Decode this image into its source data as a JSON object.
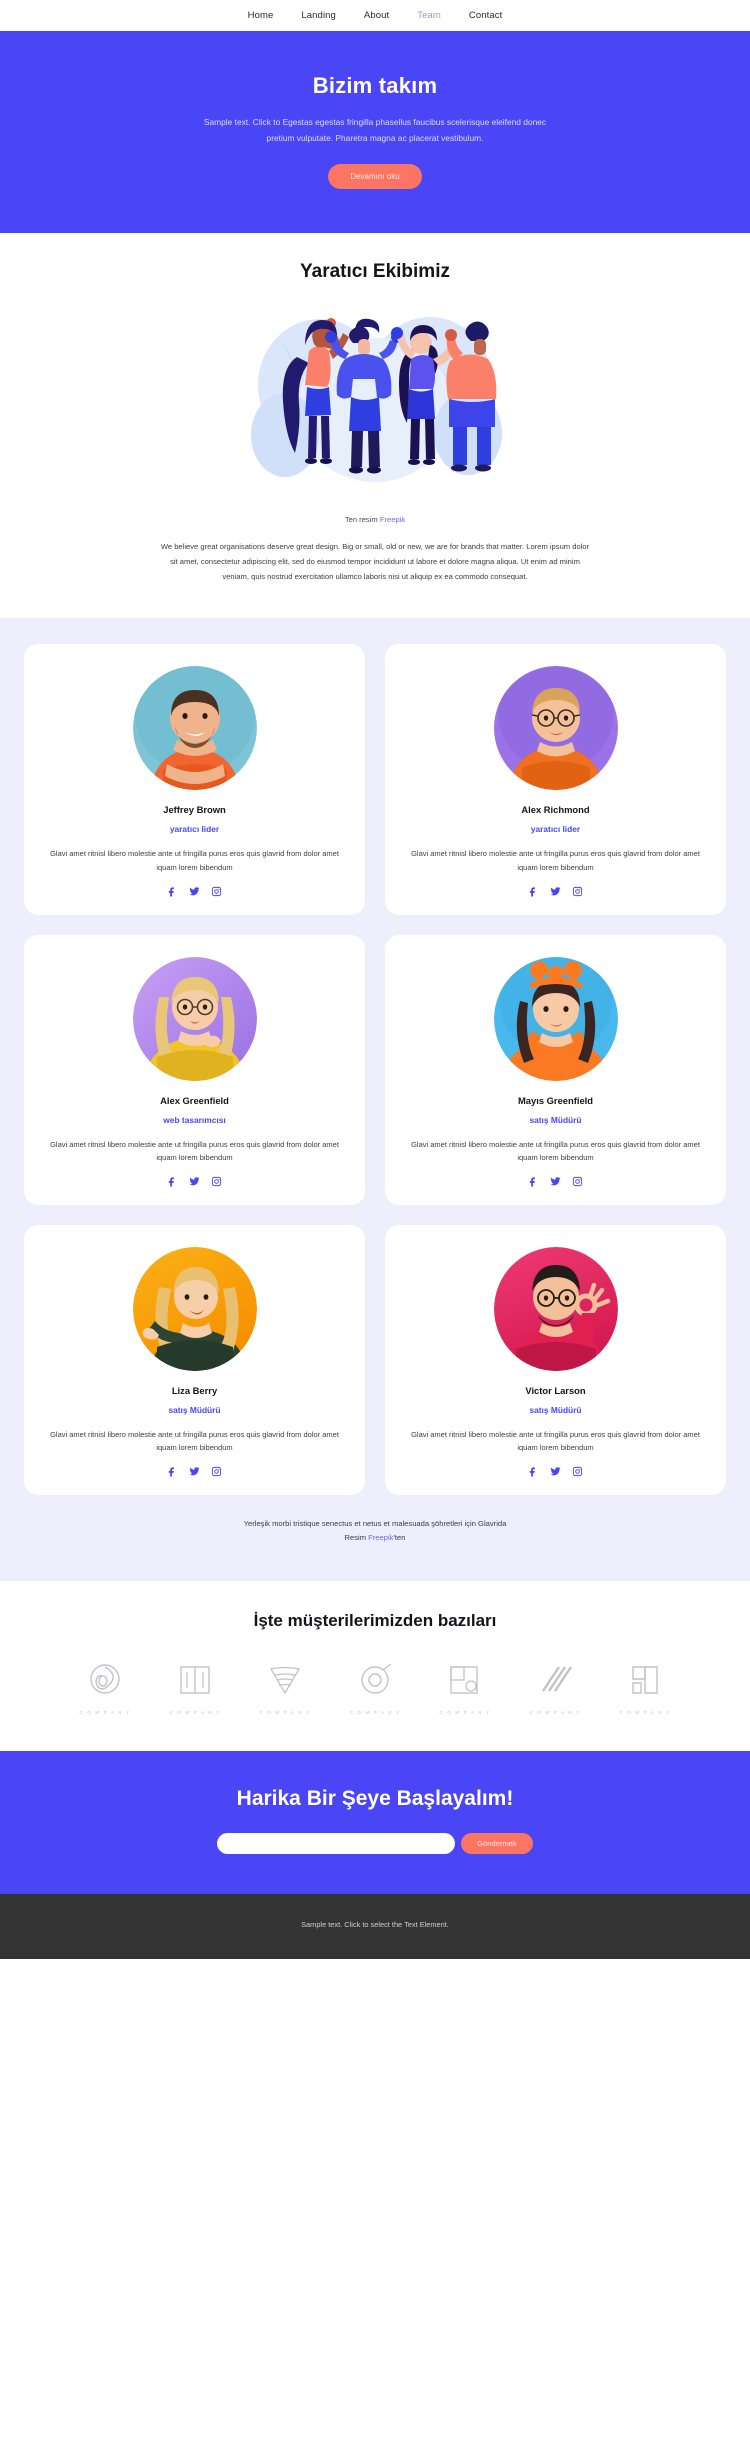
{
  "nav": {
    "items": [
      {
        "label": "Home",
        "active": false
      },
      {
        "label": "Landing",
        "active": false
      },
      {
        "label": "About",
        "active": false
      },
      {
        "label": "Team",
        "active": true
      },
      {
        "label": "Contact",
        "active": false
      }
    ]
  },
  "hero": {
    "title": "Bizim takım",
    "subtitle": "Sample text. Click to Egestas egestas fringilla phasellus faucibus scelerisque eleifend donec pretium vulputate. Pharetra magna ac placerat vestibulum.",
    "cta_label": "Devamını oku",
    "bg_color": "#4a46f5",
    "button_color": "#fc7563"
  },
  "creative": {
    "title": "Yaratıcı Ekibimiz",
    "image_credit_prefix": "Ten resim ",
    "image_credit_link": "Freepik",
    "body": "We believe great organisations deserve great design. Big or small, old or new, we are for brands that matter. Lorem ipsum dolor sit amet, consectetur adipiscing elit, sed do eiusmod tempor incididunt ut labore et dolore magna aliqua. Ut enim ad minim veniam, quis nostrud exercitation ullamco laboris nisi ut aliquip ex ea commodo consequat."
  },
  "team": {
    "bg_color": "#eeeefc",
    "role_color": "#4a46f5",
    "members": [
      {
        "name": "Jeffrey Brown",
        "role": "yaratıcı lider",
        "description": "Glavi amet ritnisl libero molestie ante ut fringilla purus eros quis glavrid from dolor amet iquam lorem bibendum",
        "avatar_bg": "#7fc4d6",
        "avatar_bg2": "#66b7cc",
        "shirt": "#f2652f",
        "hair": "#8a4a22",
        "skin": "#f0b48c"
      },
      {
        "name": "Alex Richmond",
        "role": "yaratıcı lider",
        "description": "Glavi amet ritnisl libero molestie ante ut fringilla purus eros quis glavrid from dolor amet iquam lorem bibendum",
        "avatar_bg": "#9b72e8",
        "avatar_bg2": "#8560d8",
        "shirt": "#f07020",
        "hair": "#d8a45a",
        "skin": "#f4c19a"
      },
      {
        "name": "Alex Greenfield",
        "role": "web tasarımcısı",
        "description": "Glavi amet ritnisl libero molestie ante ut fringilla purus eros quis glavrid from dolor amet iquam lorem bibendum",
        "avatar_bg": "#c29af0",
        "avatar_bg2": "#a77ee8",
        "shirt": "#f0c42a",
        "hair": "#e8c878",
        "skin": "#f6cda8"
      },
      {
        "name": "Mayıs Greenfield",
        "role": "satış Müdürü",
        "description": "Glavi amet ritnisl libero molestie ante ut fringilla purus eros quis glavrid from dolor amet iquam lorem bibendum",
        "avatar_bg": "#49b8ec",
        "avatar_bg2": "#3aa5e0",
        "shirt": "#f97a22",
        "hair": "#3a2520",
        "skin": "#f7c9a4"
      },
      {
        "name": "Liza Berry",
        "role": "satış Müdürü",
        "description": "Glavi amet ritnisl libero molestie ante ut fringilla purus eros quis glavrid from dolor amet iquam lorem bibendum",
        "avatar_bg": "#f7a80d",
        "avatar_bg2": "#f59000",
        "shirt": "#2e4433",
        "hair": "#e8c070",
        "skin": "#f6cfa8"
      },
      {
        "name": "Victor Larson",
        "role": "satış Müdürü",
        "description": "Glavi amet ritnisl libero molestie ante ut fringilla purus eros quis glavrid from dolor amet iquam lorem bibendum",
        "avatar_bg": "#e8245f",
        "avatar_bg2": "#d41a50",
        "shirt": "#e02050",
        "hair": "#241c18",
        "skin": "#f3c09a"
      }
    ],
    "footnote_line1": "Yerleşik morbi tristique senectus et netus et malesuada şöhretleri için Glavrida",
    "footnote_line2_prefix": "Resim ",
    "footnote_link": "Freepik",
    "footnote_line2_suffix": "'ten"
  },
  "clients": {
    "title": "İşte müşterilerimizden bazıları",
    "logos": [
      {
        "label": "C O M P A N Y",
        "icon": "logo-circle-swirl-icon"
      },
      {
        "label": "C O M P A N Y",
        "icon": "logo-book-icon"
      },
      {
        "label": "C O M P A N Y",
        "icon": "logo-waves-icon"
      },
      {
        "label": "C O M P A N Y",
        "icon": "logo-ring-icon"
      },
      {
        "label": "C O M P A N Y",
        "icon": "logo-squares-icon"
      },
      {
        "label": "C O M P A N Y",
        "icon": "logo-slashes-icon"
      },
      {
        "label": "C O M P A N Y",
        "icon": "logo-brackets-icon"
      }
    ]
  },
  "cta": {
    "title": "Harika Bir Şeye Başlayalım!",
    "input_value": "",
    "input_placeholder": "",
    "button_label": "Göndermek"
  },
  "footer": {
    "text": "Sample text. Click to select the Text Element.",
    "bg_color": "#333333"
  },
  "icons": {
    "facebook": "facebook-icon",
    "twitter": "twitter-icon",
    "instagram": "instagram-icon"
  }
}
